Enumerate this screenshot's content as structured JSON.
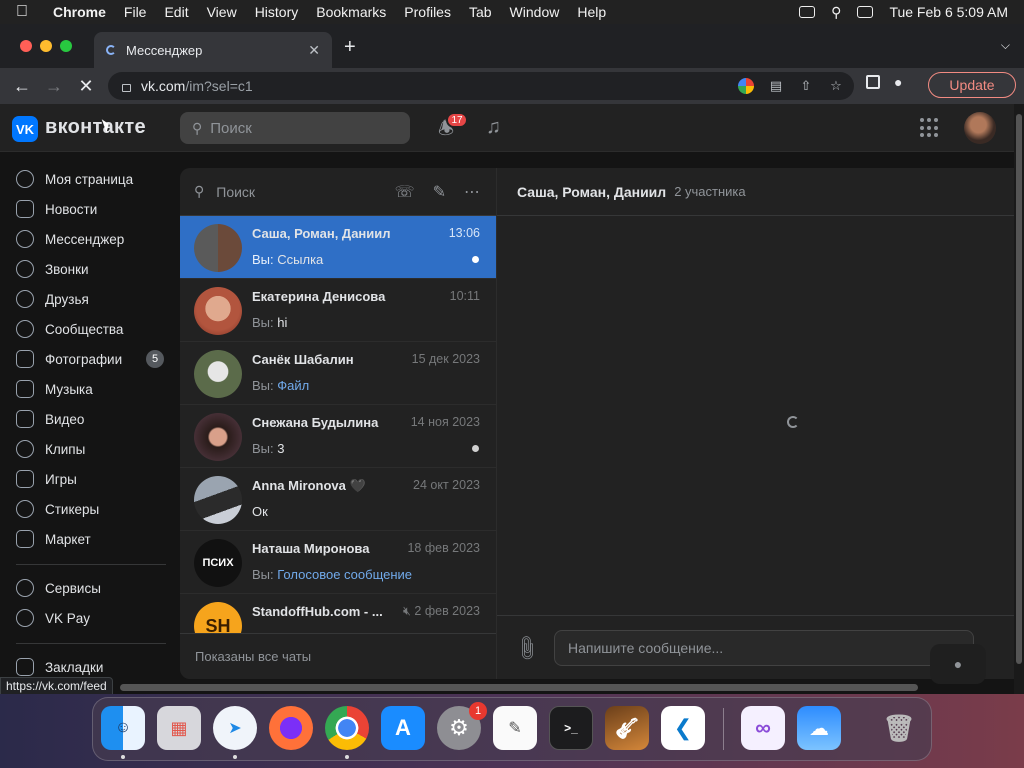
{
  "menubar": {
    "app": "Chrome",
    "items": [
      "File",
      "Edit",
      "View",
      "History",
      "Bookmarks",
      "Profiles",
      "Tab",
      "Window",
      "Help"
    ],
    "clock": "Tue Feb 6  5:09 AM"
  },
  "browser": {
    "tab_title": "Мессенджер",
    "url_host": "vk.com",
    "url_path": "/im?sel=c1",
    "update_label": "Update",
    "status_url": "https://vk.com/feed"
  },
  "vk": {
    "brand": "вконтакте",
    "logo": "VK",
    "search_placeholder": "Поиск",
    "notifications_count": "17",
    "sidebar": [
      {
        "label": "Моя страница",
        "icon": "profile-icon"
      },
      {
        "label": "Новости",
        "icon": "news-icon"
      },
      {
        "label": "Мессенджер",
        "icon": "messenger-icon"
      },
      {
        "label": "Звонки",
        "icon": "calls-icon"
      },
      {
        "label": "Друзья",
        "icon": "friends-icon"
      },
      {
        "label": "Сообщества",
        "icon": "communities-icon"
      },
      {
        "label": "Фотографии",
        "icon": "photos-icon",
        "badge": "5"
      },
      {
        "label": "Музыка",
        "icon": "music-icon"
      },
      {
        "label": "Видео",
        "icon": "video-icon"
      },
      {
        "label": "Клипы",
        "icon": "clips-icon"
      },
      {
        "label": "Игры",
        "icon": "games-icon"
      },
      {
        "label": "Стикеры",
        "icon": "stickers-icon"
      },
      {
        "label": "Маркет",
        "icon": "market-icon"
      },
      {
        "label": "Сервисы",
        "icon": "services-icon"
      },
      {
        "label": "VK Pay",
        "icon": "vkpay-icon"
      },
      {
        "label": "Закладки",
        "icon": "bookmarks-icon"
      }
    ],
    "im_search_placeholder": "Поиск",
    "conversations": [
      {
        "name": "Саша, Роман, Даниил",
        "time": "13:06",
        "prefix": "Вы: ",
        "text": "Ссылка",
        "link": false,
        "unread_dot": true
      },
      {
        "name": "Екатерина Денисова",
        "time": "10:11",
        "prefix": "Вы: ",
        "text": "hi",
        "link": false,
        "unread_dot": false
      },
      {
        "name": "Санёк Шабалин",
        "time": "15 дек 2023",
        "prefix": "Вы: ",
        "text": "Файл",
        "link": true,
        "unread_dot": false
      },
      {
        "name": "Снежана Будылина",
        "time": "14 ноя 2023",
        "prefix": "Вы: ",
        "text": "3",
        "link": false,
        "unread_dot": true
      },
      {
        "name": "Anna Mironova 🖤",
        "time": "24 окт 2023",
        "prefix": "",
        "text": "Ок",
        "link": false,
        "unread_dot": false
      },
      {
        "name": "Наташа Миронова",
        "time": "18 фев 2023",
        "prefix": "Вы: ",
        "text": "Голосовое сообщение",
        "link": true,
        "unread_dot": false
      },
      {
        "name": "StandoffHub.com - ...",
        "time": "2 фев 2023",
        "prefix": "",
        "text": "",
        "link": false,
        "unread_dot": false
      }
    ],
    "im_footer": "Показаны все чаты",
    "chat": {
      "title": "Саша, Роман, Даниил",
      "members": "2 участника",
      "input_placeholder": "Напишите сообщение..."
    }
  },
  "dock": {
    "apps": [
      "Finder",
      "Launchpad",
      "Safari",
      "Firefox",
      "Chrome",
      "App Store",
      "System Settings",
      "TextEdit",
      "Terminal",
      "GarageBand",
      "Visual Studio Code",
      "Visual Studio",
      "Weather",
      "Trash"
    ],
    "settings_badge": "1"
  },
  "colors": {
    "vk_blue": "#0077ff",
    "active_conversation": "#2f6fc6",
    "link": "#71aaeb"
  }
}
